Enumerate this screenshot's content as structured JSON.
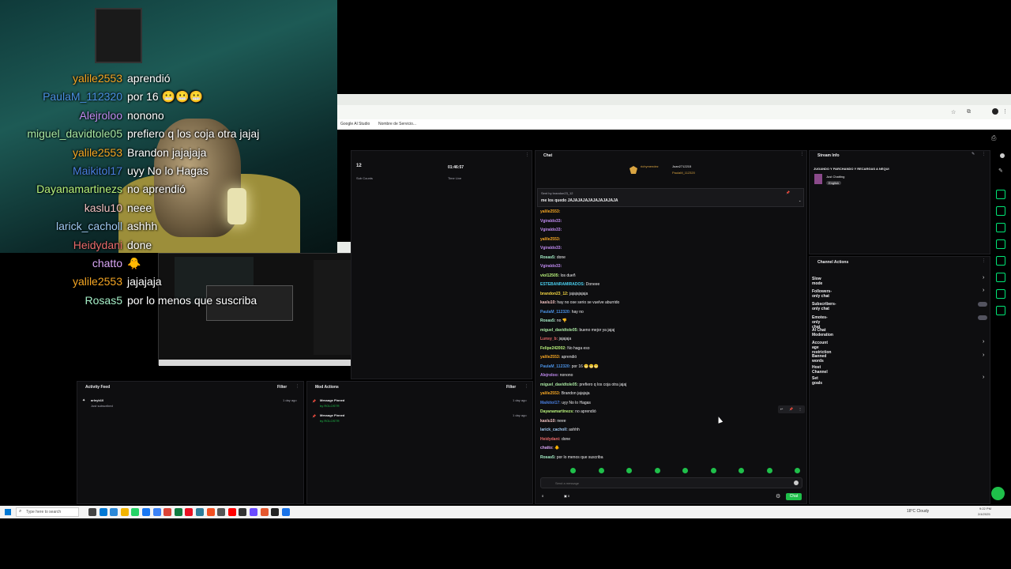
{
  "overlay_chat": [
    {
      "user": "yalile2553",
      "msg": "aprendió",
      "color": "#f5a623"
    },
    {
      "user": "PaulaM_112320",
      "msg": "por 16 😬😬😬",
      "color": "#4a90e2"
    },
    {
      "user": "Alejroloo",
      "msg": "nonono",
      "color": "#c08bf0"
    },
    {
      "user": "miguel_davidtole05",
      "msg": "prefiero q los coja otra jajaj",
      "color": "#a8e6a1"
    },
    {
      "user": "yalile2553",
      "msg": "Brandon jajajaja",
      "color": "#f5a623"
    },
    {
      "user": "Maikitol17",
      "msg": "uyy No lo Hagas",
      "color": "#4a7fe0"
    },
    {
      "user": "Dayanamartinezs",
      "msg": "no aprendió",
      "color": "#b7f07a"
    },
    {
      "user": "kaslu10",
      "msg": "neee",
      "color": "#f0c0c0"
    },
    {
      "user": "larick_cacholl",
      "msg": "ashhh",
      "color": "#a0c8f0"
    },
    {
      "user": "Heidydani",
      "msg": "done",
      "color": "#e86a6a"
    },
    {
      "user": "chatto",
      "msg": "🐥",
      "color": "#d9a6f5"
    },
    {
      "user": "yalile2553",
      "msg": "jajajaja",
      "color": "#f5a623"
    },
    {
      "user": "Rosas5",
      "msg": "por lo menos que suscriba",
      "color": "#a6f0c8"
    }
  ],
  "browser": {
    "bookmark1": "Google Al Studio",
    "bookmark2": "Nombre de Servicio..."
  },
  "stats": {
    "sub_count": "12",
    "sub_label": "Sub Counts",
    "time_live": "01:46:57",
    "time_label": "Time Live"
  },
  "chat": {
    "title": "Chat",
    "leaders": [
      {
        "name": "richymendez"
      },
      {
        "name": "Juan2712215",
        "count": "1"
      },
      {
        "name": "PaulaM_112320",
        "count": "1"
      }
    ],
    "pinned_by": "Sent by brandon23_12",
    "pinned_msg": "me los quedo JAJAJAJAJAJAJAJAJAJA",
    "lines": [
      {
        "user": "yalile2553:",
        "msg": "",
        "color": "#f5a623"
      },
      {
        "user": "Vgiraldo33:",
        "msg": "",
        "color": "#c08bf0"
      },
      {
        "user": "Vgiraldo33:",
        "msg": "",
        "color": "#c08bf0"
      },
      {
        "user": "yalile2553:",
        "msg": "",
        "color": "#f5a623"
      },
      {
        "user": "Vgiraldo33:",
        "msg": "",
        "color": "#c08bf0"
      },
      {
        "user": "Rosas5:",
        "msg": "done",
        "color": "#a6f0c8"
      },
      {
        "user": "Vgiraldo33:",
        "msg": "",
        "color": "#c08bf0"
      },
      {
        "user": "vioI12505:",
        "msg": "los dueñ",
        "color": "#b7f07a"
      },
      {
        "user": "ESTEBANRAMIRADOS:",
        "msg": "Doneee",
        "color": "#4ad0f0"
      },
      {
        "user": "brandon23_12:",
        "msg": "jajajajajaja",
        "color": "#f5d742"
      },
      {
        "user": "kaslu10:",
        "msg": "hay no ose serio se vuelve aburrido",
        "color": "#f0c0c0"
      },
      {
        "user": "PaulaM_112320:",
        "msg": "hay no",
        "color": "#4a90e2"
      },
      {
        "user": "Rosas5:",
        "msg": "no 👎",
        "color": "#a6f0c8"
      },
      {
        "user": "miguel_davidtole05:",
        "msg": "bueno mejor ya jajaj",
        "color": "#a8e6a1"
      },
      {
        "user": "Lunsy_b:",
        "msg": "jajajaja",
        "color": "#e86a6a"
      },
      {
        "user": "Felipe242002:",
        "msg": "No haga eso",
        "color": "#b7f07a"
      },
      {
        "user": "yalile2553:",
        "msg": "aprendió",
        "color": "#f5a623"
      },
      {
        "user": "PaulaM_112320:",
        "msg": "por 16 😬😬😬",
        "color": "#4a90e2"
      },
      {
        "user": "Alejroloo:",
        "msg": "nonono",
        "color": "#c08bf0"
      },
      {
        "user": "miguel_davidtole05:",
        "msg": "prefiero q los coja otra jajaj",
        "color": "#a8e6a1"
      },
      {
        "user": "yalile2553:",
        "msg": "Brandon jajajaja",
        "color": "#f5a623"
      },
      {
        "user": "Maikitol17:",
        "msg": "uyy No lo Hagas",
        "color": "#4a7fe0"
      },
      {
        "user": "Dayanamartinezs:",
        "msg": "no aprendió",
        "color": "#b7f07a"
      },
      {
        "user": "kaslu10:",
        "msg": "neee",
        "color": "#f0c0c0"
      },
      {
        "user": "larick_cacholl:",
        "msg": "ashhh",
        "color": "#a0c8f0"
      },
      {
        "user": "Heidydani:",
        "msg": "done",
        "color": "#e86a6a"
      },
      {
        "user": "chatto:",
        "msg": "🐥",
        "color": "#d9a6f5"
      },
      {
        "user": "Rosas5:",
        "msg": "por lo menos que suscriba",
        "color": "#a6f0c8"
      }
    ],
    "input_placeholder": "Send a message",
    "points": "0",
    "send_label": "Chat"
  },
  "stream_info": {
    "title": "Stream Info",
    "stream_title": "JUGANDO Y PARCHANDO Y RECARGAS A NEQUI",
    "category": "Just Chatting",
    "tag": "English"
  },
  "channel_actions": {
    "title": "Channel Actions",
    "items": [
      "Slow mode",
      "Followers-only chat",
      "Subscribers-only chat",
      "Emotes-only chat",
      "AI Chat Moderation",
      "Account age restriction",
      "Banned words",
      "Host Channel",
      "Set goals"
    ]
  },
  "activity_feed": {
    "title": "Activity Feed",
    "filter": "Filter",
    "items": [
      {
        "user": "arleyb10",
        "desc": "Just subscribed",
        "time": "1 day ago"
      }
    ]
  },
  "mod_actions": {
    "title": "Mod Actions",
    "filter": "Filter",
    "items": [
      {
        "action": "Message Pinned",
        "by": "by ROLOSTR",
        "time": "1 day ago"
      },
      {
        "action": "Message Pinned",
        "by": "by ROLOSTR",
        "time": "1 day ago"
      }
    ]
  },
  "taskbar": {
    "search": "Type here to search",
    "weather": "18°C Cloudy",
    "time": "9:22 PM",
    "date": "2/4/2025"
  }
}
